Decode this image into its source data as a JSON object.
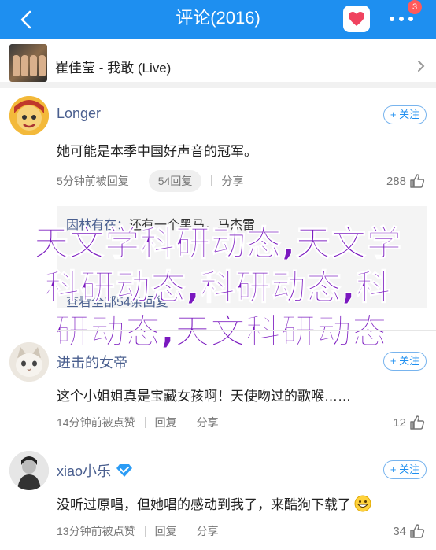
{
  "header": {
    "title": "评论(2016)",
    "badge": "3"
  },
  "song": {
    "title": "崔佳莹 - 我敢 (Live)"
  },
  "comments": [
    {
      "username": "Longer",
      "follow_label": "+ 关注",
      "text": "她可能是本季中国好声音的冠军。",
      "time": "5分钟前被回复",
      "replies": "54回复",
      "share": "分享",
      "likes": "288"
    },
    {
      "username": "进击的女帝",
      "follow_label": "+ 关注",
      "text": "这个小姐姐真是宝藏女孩啊！天使吻过的歌喉……",
      "time": "14分钟前被点赞",
      "replies": "回复",
      "share": "分享",
      "likes": "12"
    },
    {
      "username": "xiao小乐",
      "follow_label": "+ 关注",
      "text": "没听过原唱，但她唱的感动到我了，来酷狗下载了",
      "time": "13分钟前被点赞",
      "replies": "回复",
      "share": "分享",
      "likes": "34"
    }
  ],
  "quote": {
    "user1": "因林有在：",
    "line1": "还有一个黑马，马杰雷",
    "line4": "查看全部54条回复"
  },
  "watermark": {
    "line1": "天文学科研动态,天文学",
    "line2": "科研动态,科研动态,科",
    "line3": "研动态,天文科研动态"
  },
  "colors": {
    "header_bg": "#1e8ff0",
    "username": "#4a5f8f",
    "watermark": "#7a18bf"
  }
}
